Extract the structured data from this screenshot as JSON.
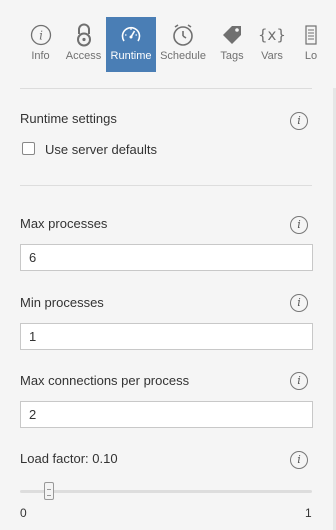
{
  "tabs": [
    {
      "label": "Info",
      "icon": "info-icon"
    },
    {
      "label": "Access",
      "icon": "lock-icon"
    },
    {
      "label": "Runtime",
      "icon": "gauge-icon",
      "active": true
    },
    {
      "label": "Schedule",
      "icon": "clock-icon"
    },
    {
      "label": "Tags",
      "icon": "tag-icon"
    },
    {
      "label": "Vars",
      "icon": "variable-icon"
    },
    {
      "label": "Lo",
      "icon": "log-icon"
    }
  ],
  "runtime": {
    "section_title": "Runtime settings",
    "use_server_defaults_label": "Use server defaults",
    "use_server_defaults_checked": false,
    "max_processes": {
      "label": "Max processes",
      "value": "6"
    },
    "min_processes": {
      "label": "Min processes",
      "value": "1"
    },
    "max_connections": {
      "label": "Max connections per process",
      "value": "2"
    },
    "load_factor": {
      "label": "Load factor: 0.10",
      "value": 0.1,
      "min_label": "0",
      "max_label": "1"
    }
  },
  "info_glyph": "i",
  "colors": {
    "active_tab": "#4a7eb5",
    "background": "#f5f5f5"
  }
}
